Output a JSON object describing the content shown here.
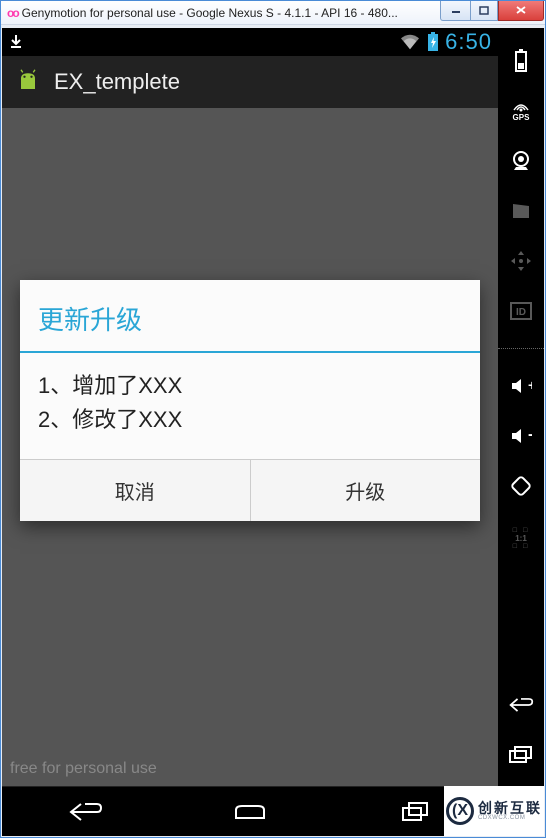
{
  "window": {
    "title": "Genymotion for personal use - Google Nexus S - 4.1.1 - API 16 - 480..."
  },
  "status": {
    "clock": "6:50"
  },
  "app": {
    "title": "EX_templete"
  },
  "dialog": {
    "title": "更新升级",
    "line1": "1、增加了XXX",
    "line2": "2、修改了XXX",
    "cancel": "取消",
    "confirm": "升级"
  },
  "watermark": "free for personal use",
  "side": {
    "gps": "GPS",
    "id": "ID",
    "ratio": "1:1"
  },
  "brand": {
    "cn": "创新互联",
    "en": "CDXWCX.COM"
  }
}
